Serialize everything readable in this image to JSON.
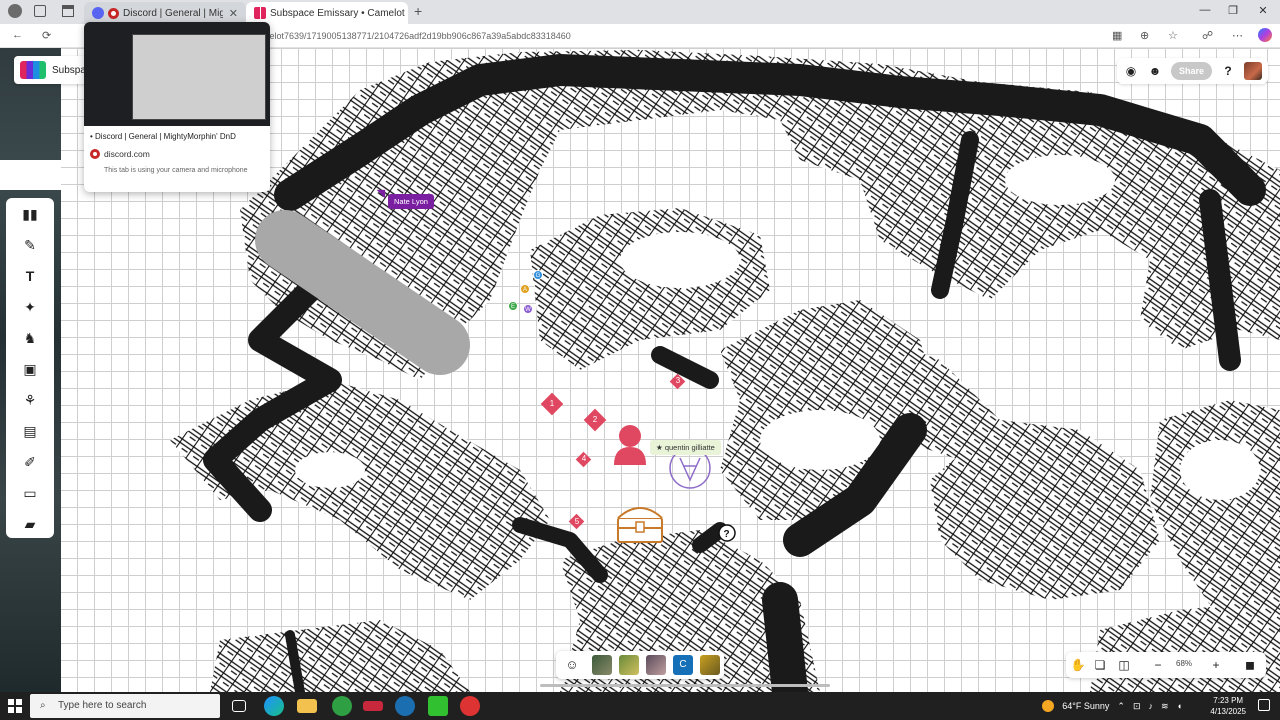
{
  "browser": {
    "tabs": [
      {
        "title": "Discord | General | MightyMorphin' DnD",
        "active": false
      },
      {
        "title": "Subspace Emissary • Camelot",
        "active": true
      }
    ],
    "new_tab_icon": "plus-icon",
    "url": "melot7639/1719005138771/2104726adf2d19bb906c867a39a5abdc83318460",
    "window_controls": [
      "minimize-icon",
      "restore-icon",
      "close-icon"
    ]
  },
  "tab_preview": {
    "title": "• Discord | General | MightyMorphin' DnD",
    "domain": "discord.com",
    "note": "This tab is using your camera and microphone"
  },
  "app": {
    "name": "Subspa",
    "header_buttons": [
      "chat-icon",
      "person-icon"
    ],
    "share_label": "Share",
    "help_label": "?"
  },
  "map": {
    "player_label": "Nate Lyon",
    "token_label": "quentin gilliatte",
    "markers": [
      "1",
      "2",
      "3",
      "4",
      "5"
    ],
    "party_dots": [
      "G",
      "A",
      "E",
      "W"
    ],
    "accent_color": "#e04862",
    "player_color": "#7b1fa2"
  },
  "dock": {
    "items": [
      "emoji-icon",
      "avatar-1",
      "avatar-2",
      "avatar-3",
      "C",
      "avatar-5"
    ]
  },
  "zoom": {
    "level": "68%"
  },
  "taskbar": {
    "search_placeholder": "Type here to search",
    "weather": "64°F  Sunny",
    "time": "7:23 PM",
    "date": "4/13/2025"
  }
}
